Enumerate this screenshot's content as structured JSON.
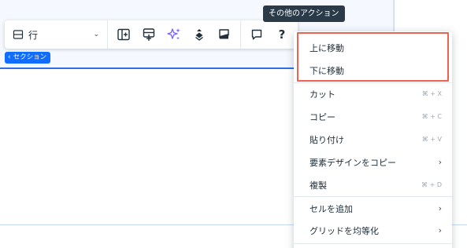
{
  "canvas": {
    "section_tag": "セクション"
  },
  "toolbar": {
    "element_type": "行",
    "buttons": [
      {
        "name": "add-column-icon"
      },
      {
        "name": "add-row-icon"
      },
      {
        "name": "ai-sparkle-icon"
      },
      {
        "name": "layers-arrange-icon"
      },
      {
        "name": "background-icon"
      },
      {
        "name": "comment-icon"
      },
      {
        "name": "help-icon"
      }
    ],
    "help_glyph": "?"
  },
  "tooltip": {
    "text": "その他のアクション"
  },
  "menu": {
    "items": [
      {
        "label": "上に移動",
        "shortcut": ""
      },
      {
        "label": "下に移動",
        "shortcut": ""
      },
      {
        "label": "カット",
        "shortcut": "⌘ + X"
      },
      {
        "label": "コピー",
        "shortcut": "⌘ + C"
      },
      {
        "label": "貼り付け",
        "shortcut": "⌘ + V"
      },
      {
        "label": "要素デザインをコピー",
        "arrow": "›"
      },
      {
        "label": "複製",
        "shortcut": "⌘ + D"
      },
      {
        "label": "セルを追加",
        "arrow": "›"
      },
      {
        "label": "グリッドを均等化",
        "arrow": "›"
      }
    ]
  },
  "colors": {
    "accent": "#116dff",
    "highlight": "#ee6254",
    "sparkle": "#7b61ff",
    "tooltip_bg": "#2b3a48"
  }
}
